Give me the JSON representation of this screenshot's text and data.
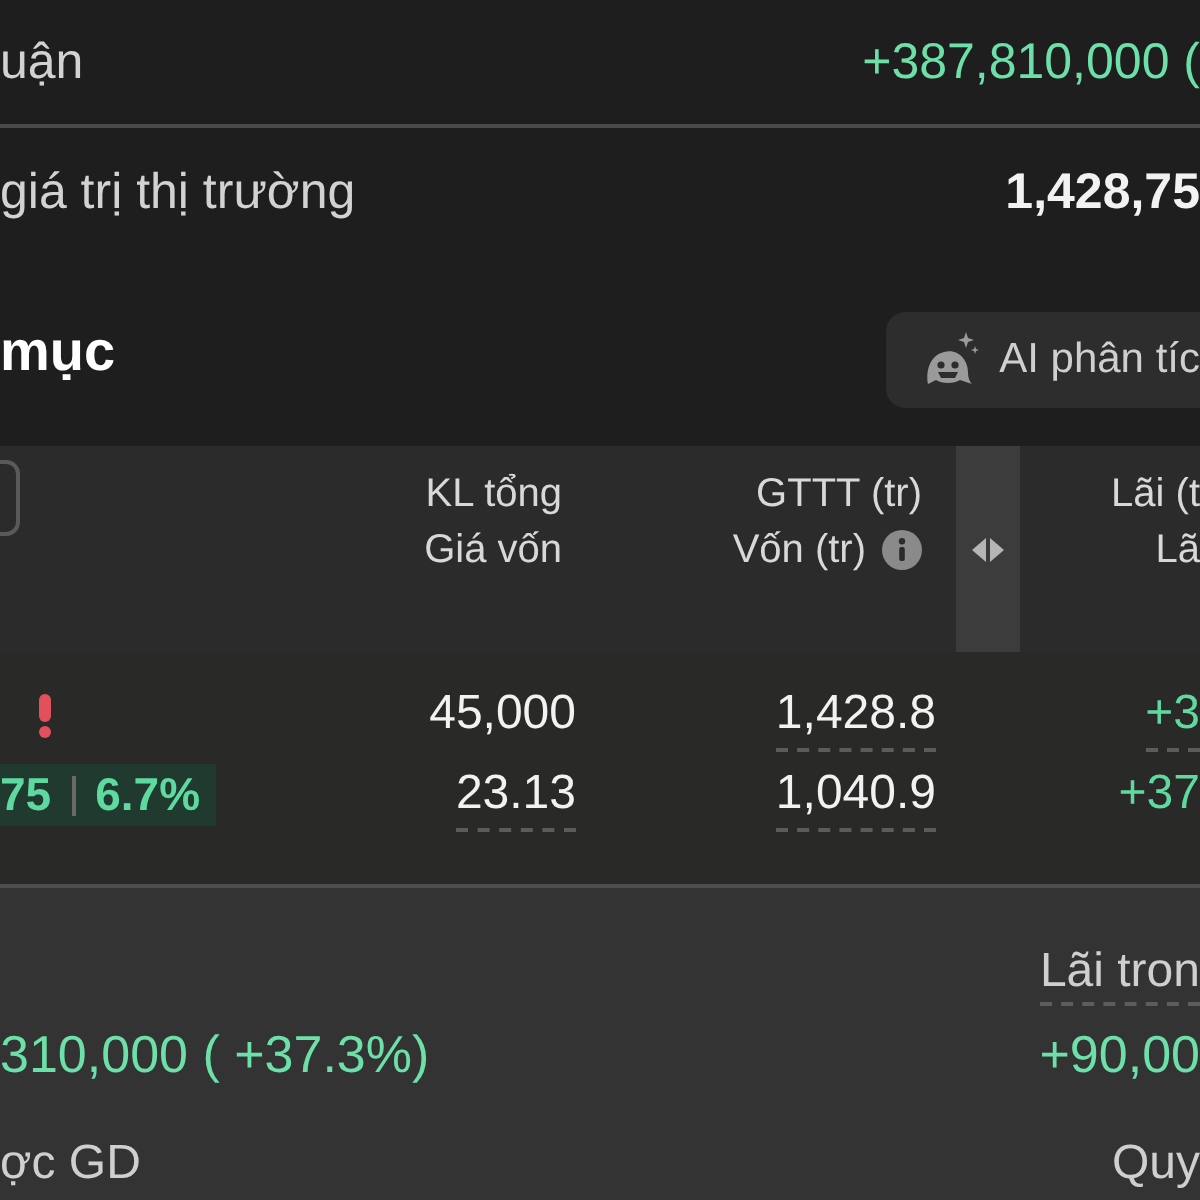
{
  "summary": [
    {
      "label": "uận",
      "value": "+387,810,000 (",
      "positive": true,
      "emphasis": false
    },
    {
      "label": "giá trị thị trường",
      "value": "1,428,75",
      "positive": false,
      "emphasis": true
    }
  ],
  "section": {
    "title": "mục",
    "ai_button": {
      "label": "AI phân tíc"
    }
  },
  "table": {
    "columns": [
      {
        "line_1": "KL tổng",
        "line_2": "Giá vốn",
        "info": false
      },
      {
        "line_1": "GTTT (tr)",
        "line_2": "Vốn (tr)",
        "info": true
      },
      {
        "line_1": "Lãi (t",
        "line_2": "Lã",
        "info": false
      }
    ],
    "rows": [
      {
        "alert": true,
        "badge": {
          "price": "75",
          "change": "6.7%"
        },
        "cells": [
          [
            {
              "text": "45,000",
              "positive": false,
              "dashed": false
            },
            {
              "text": "23.13",
              "positive": false,
              "dashed": true
            }
          ],
          [
            {
              "text": "1,428.8",
              "positive": false,
              "dashed": true
            },
            {
              "text": "1,040.9",
              "positive": false,
              "dashed": true
            }
          ],
          [
            {
              "text": "+3",
              "positive": true,
              "dashed": true
            },
            {
              "text": "+37",
              "positive": true,
              "dashed": false
            }
          ]
        ]
      }
    ]
  },
  "footer": {
    "left": [
      {
        "kind": "value",
        "text": "310,000 ( +37.3%)",
        "positive": true,
        "dashed": false
      },
      {
        "kind": "label",
        "text": "ợc GD",
        "positive": false,
        "dashed": false
      }
    ],
    "right": [
      {
        "kind": "label",
        "text": "Lãi tron",
        "positive": false,
        "dashed": true
      },
      {
        "kind": "value",
        "text": "+90,00",
        "positive": true,
        "dashed": false
      },
      {
        "kind": "label",
        "text": "Quy",
        "positive": false,
        "dashed": false
      }
    ]
  }
}
